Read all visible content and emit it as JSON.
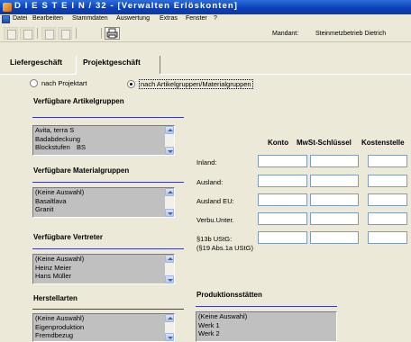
{
  "window": {
    "title": "D I E S T E I N / 32 - [Verwalten Erlöskonten]"
  },
  "menu": [
    "Datei",
    "Bearbeiten",
    "Stammdaten",
    "Auswertung",
    "Extras",
    "Fenster",
    "?"
  ],
  "header": {
    "mandant_label": "Mandant:",
    "mandant_value": "Steinmetzbetrieb Dietrich"
  },
  "tabs": [
    {
      "label": "Liefergeschäft",
      "active": false
    },
    {
      "label": "Projektgeschäft",
      "active": true
    }
  ],
  "radios": [
    {
      "label": "nach Projektart",
      "selected": false
    },
    {
      "label": "nach Artikelgruppen/Materialgruppen",
      "selected": true
    }
  ],
  "sections": {
    "artikelgruppen": {
      "title": "Verfügbare Artikelgruppen",
      "items": [
        {
          "label": "Avita, terra S",
          "code": ""
        },
        {
          "label": "Badabdeckung",
          "code": ""
        },
        {
          "label": "Blockstufen",
          "code": "BS"
        }
      ]
    },
    "materialgruppen": {
      "title": "Verfügbare Materialgruppen",
      "items": [
        "(Keine Auswahl)",
        "Basaltlava",
        "Granit"
      ]
    },
    "vertreter": {
      "title": "Verfügbare Vertreter",
      "items": [
        "(Keine Auswahl)",
        "Heinz Meier",
        "Hans Müller"
      ]
    },
    "herstellarten": {
      "title": "Herstellarten",
      "items": [
        "(Keine Auswahl)",
        "Eigenproduktion",
        "Fremdbezug"
      ]
    },
    "produktionsstaetten": {
      "title": "Produktionsstätten",
      "items": [
        "(Keine Auswahl)",
        "Werk 1",
        "Werk 2"
      ]
    }
  },
  "konten_table": {
    "columns": [
      "Konto",
      "MwSt-Schlüssel",
      "Kostenstelle"
    ],
    "rows": [
      {
        "label": "Inland:",
        "konto": "",
        "mwst": "",
        "kostenstelle": ""
      },
      {
        "label": "Ausland:",
        "konto": "",
        "mwst": "",
        "kostenstelle": ""
      },
      {
        "label": "Ausland EU:",
        "konto": "",
        "mwst": "",
        "kostenstelle": ""
      },
      {
        "label": "Verbu.Unter.",
        "konto": "",
        "mwst": "",
        "kostenstelle": ""
      },
      {
        "label": "§13b UStG:",
        "konto": "",
        "mwst": "",
        "kostenstelle": ""
      }
    ],
    "note": "(§19 Abs.1a UStG)"
  }
}
